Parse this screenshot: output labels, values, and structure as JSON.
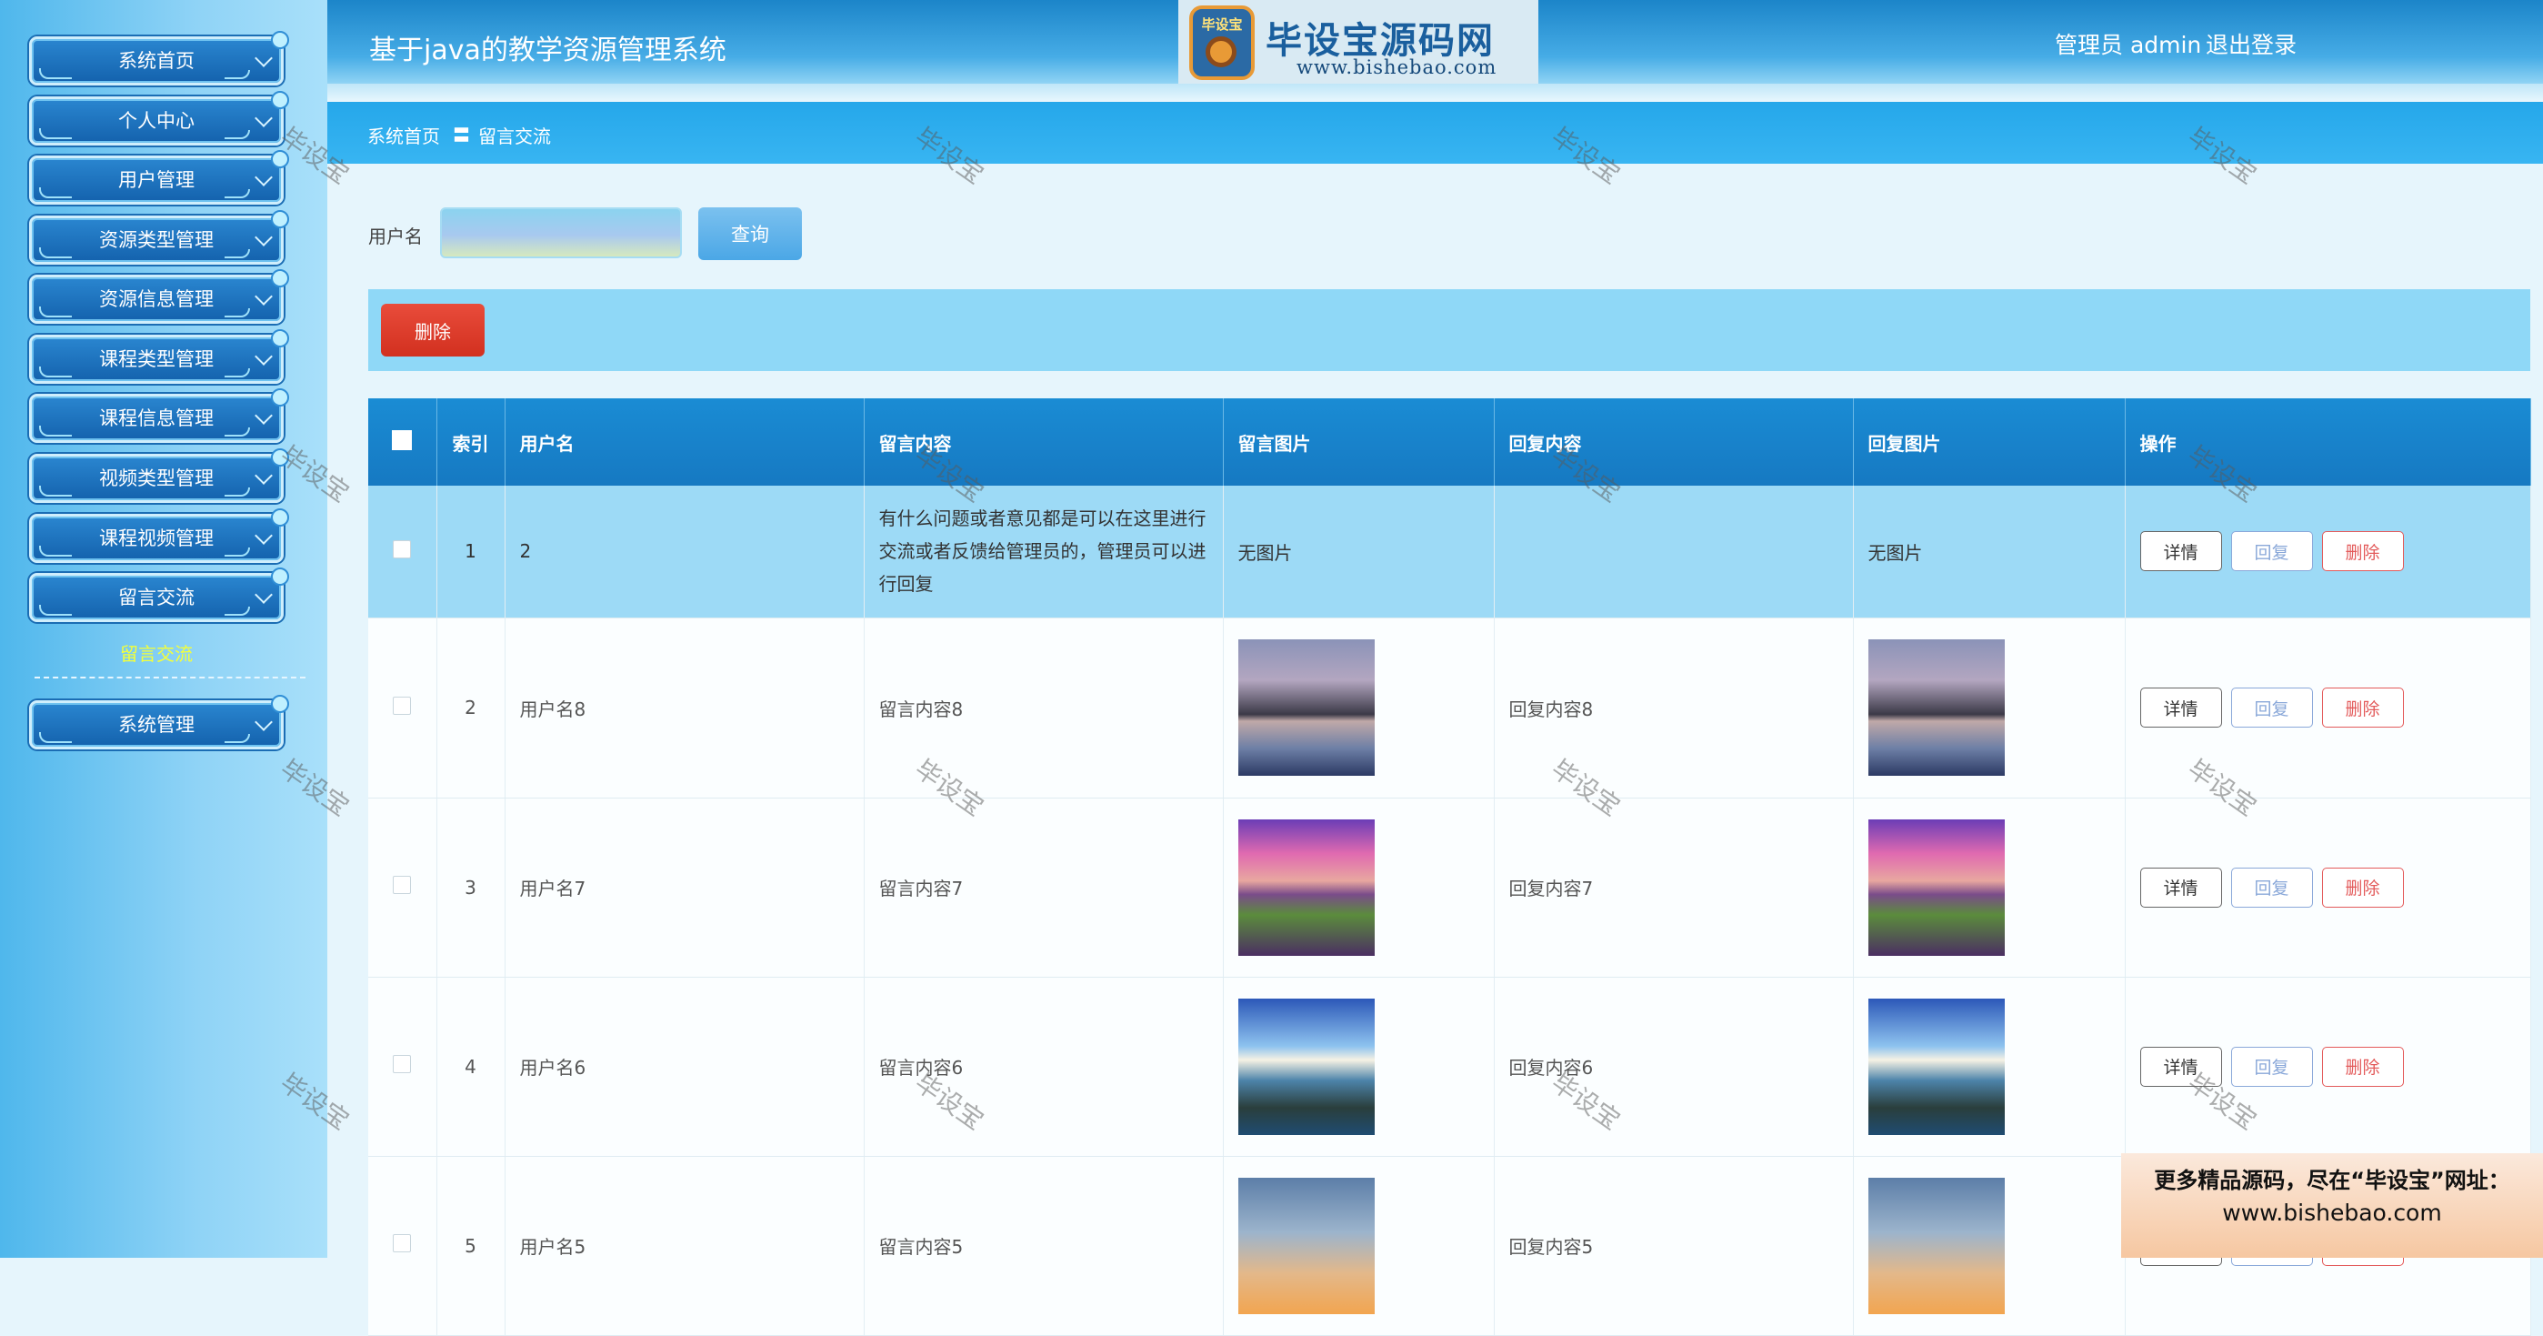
{
  "header": {
    "app_title": "基于java的教学资源管理系统",
    "user_info": "管理员 admin",
    "logout": "退出登录",
    "logo": {
      "badge": "毕设宝",
      "name": "毕设宝源码网",
      "url": "www.bishebao.com"
    }
  },
  "sidebar": {
    "items": [
      {
        "label": "系统首页"
      },
      {
        "label": "个人中心"
      },
      {
        "label": "用户管理"
      },
      {
        "label": "资源类型管理"
      },
      {
        "label": "资源信息管理"
      },
      {
        "label": "课程类型管理"
      },
      {
        "label": "课程信息管理"
      },
      {
        "label": "视频类型管理"
      },
      {
        "label": "课程视频管理"
      },
      {
        "label": "留言交流"
      }
    ],
    "sub_item": "留言交流",
    "system": "系统管理"
  },
  "breadcrumb": {
    "home": "系统首页",
    "separator": "〓",
    "current": "留言交流"
  },
  "search": {
    "label": "用户名",
    "value": "",
    "placeholder": "",
    "button": "查询"
  },
  "actions": {
    "delete": "删除"
  },
  "table": {
    "headers": [
      "索引",
      "用户名",
      "留言内容",
      "留言图片",
      "回复内容",
      "回复图片",
      "操作"
    ],
    "rows": [
      {
        "index": "1",
        "user": "2",
        "content": "有什么问题或者意见都是可以在这里进行交流或者反馈给管理员的，管理员可以进行回复",
        "image": "无图片",
        "reply": "",
        "reply_image": "无图片"
      },
      {
        "index": "2",
        "user": "用户名8",
        "content": "留言内容8",
        "image": "mountain-lake-photo",
        "reply": "回复内容8",
        "reply_image": "mountain-lake-photo"
      },
      {
        "index": "3",
        "user": "用户名7",
        "content": "留言内容7",
        "image": "purple-sunset-coast-photo",
        "reply": "回复内容7",
        "reply_image": "purple-sunset-coast-photo"
      },
      {
        "index": "4",
        "user": "用户名6",
        "content": "留言内容6",
        "image": "rocky-blue-sea-photo",
        "reply": "回复内容6",
        "reply_image": "rocky-blue-sea-photo"
      },
      {
        "index": "5",
        "user": "用户名5",
        "content": "留言内容5",
        "image": "karst-sunset-photo",
        "reply": "回复内容5",
        "reply_image": "karst-sunset-photo"
      }
    ],
    "op_labels": {
      "detail": "详情",
      "reply": "回复",
      "delete": "删除"
    }
  },
  "watermark": "毕设宝",
  "promo": {
    "line1": "更多精品源码，尽在“毕设宝”网址：",
    "line2": "www.bishebao.com"
  }
}
